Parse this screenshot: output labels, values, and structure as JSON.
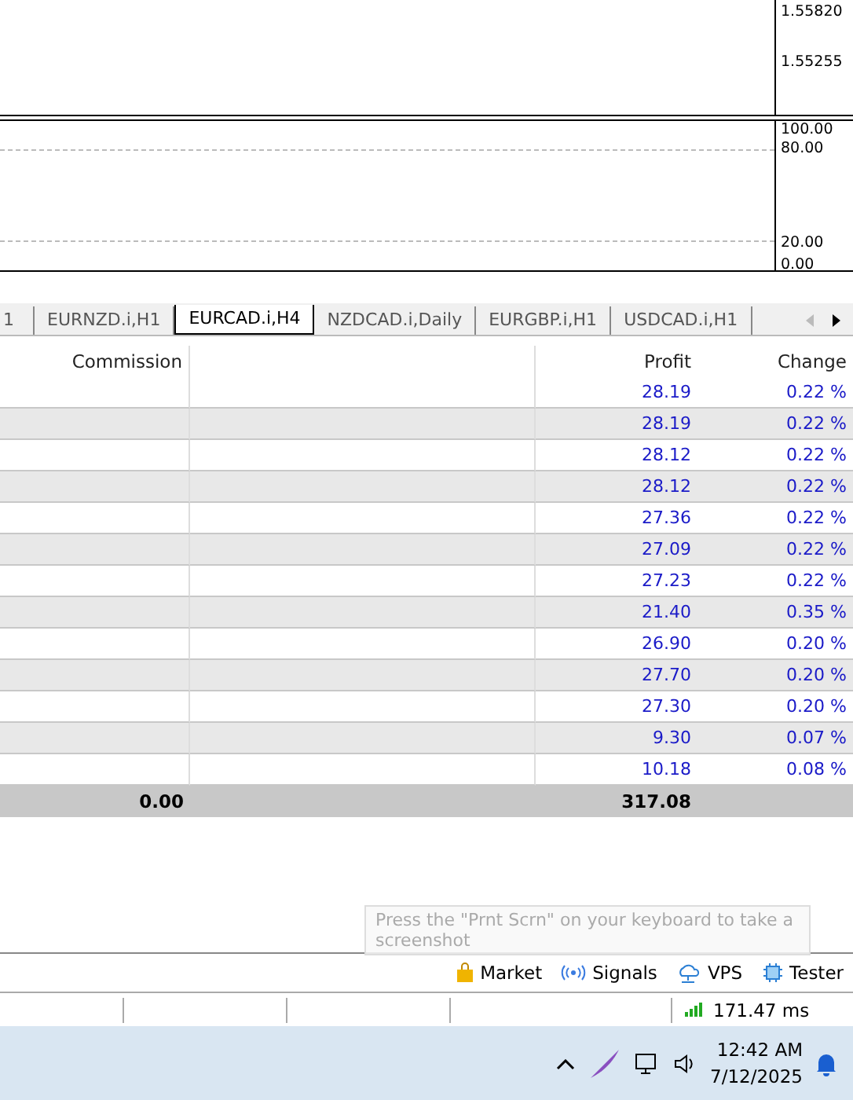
{
  "price_axis": [
    "1.55820",
    "1.55255"
  ],
  "indicator_axis": [
    "100.00",
    "80.00",
    "20.00",
    "0.00"
  ],
  "chart_tabs": [
    {
      "label": "1",
      "selected": false
    },
    {
      "label": "EURNZD.i,H1",
      "selected": false
    },
    {
      "label": "EURCAD.i,H4",
      "selected": true
    },
    {
      "label": "NZDCAD.i,Daily",
      "selected": false
    },
    {
      "label": "EURGBP.i,H1",
      "selected": false
    },
    {
      "label": "USDCAD.i,H1",
      "selected": false
    }
  ],
  "table": {
    "columns": [
      "Commission",
      "",
      "Profit",
      "Change"
    ],
    "rows": [
      {
        "profit": "28.19",
        "change": "0.22 %"
      },
      {
        "profit": "28.19",
        "change": "0.22 %"
      },
      {
        "profit": "28.12",
        "change": "0.22 %"
      },
      {
        "profit": "28.12",
        "change": "0.22 %"
      },
      {
        "profit": "27.36",
        "change": "0.22 %"
      },
      {
        "profit": "27.09",
        "change": "0.22 %"
      },
      {
        "profit": "27.23",
        "change": "0.22 %"
      },
      {
        "profit": "21.40",
        "change": "0.35 %"
      },
      {
        "profit": "26.90",
        "change": "0.20 %"
      },
      {
        "profit": "27.70",
        "change": "0.20 %"
      },
      {
        "profit": "27.30",
        "change": "0.20 %"
      },
      {
        "profit": "9.30",
        "change": "0.07 %"
      },
      {
        "profit": "10.18",
        "change": "0.08 %"
      }
    ],
    "total": {
      "commission": "0.00",
      "profit": "317.08"
    }
  },
  "toolbar": [
    {
      "label": "Market",
      "kind": "bag"
    },
    {
      "label": "Signals",
      "kind": "signal"
    },
    {
      "label": "VPS",
      "kind": "cloud"
    },
    {
      "label": "Tester",
      "kind": "chip"
    }
  ],
  "tooltip": "Press the \"Prnt Scrn\" on your keyboard to take a screenshot",
  "status": {
    "ping": "171.47 ms"
  },
  "taskbar": {
    "time": "12:42 AM",
    "date": "7/12/2025"
  }
}
